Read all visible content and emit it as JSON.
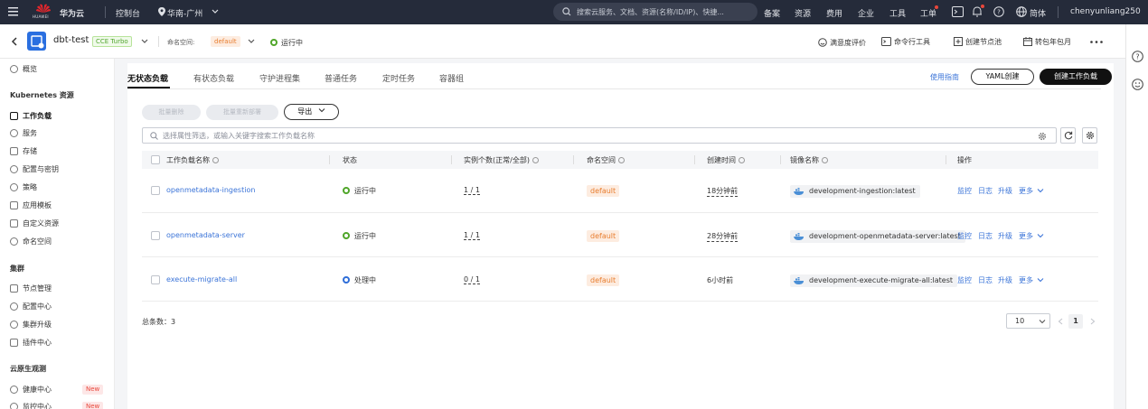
{
  "topbar": {
    "brand_text": "HUAWEI",
    "brand_name": "华为云",
    "console": "控制台",
    "region": "华南-广州",
    "search_placeholder": "搜索云服务、文档、资源(名称/ID/IP)、快捷...",
    "links": [
      "备案",
      "资源",
      "费用",
      "企业",
      "工具",
      "工单"
    ],
    "lang": "简体",
    "user": "chenyunliang250"
  },
  "cluster": {
    "name": "dbt-test",
    "type_badge": "CCE Turbo",
    "namespace_label": "命名空间:",
    "namespace_value": "default",
    "status": "运行中",
    "actions": [
      "满意度评价",
      "命令行工具",
      "创建节点池",
      "转包年包月"
    ]
  },
  "sidebar": {
    "overview": "概览",
    "k8s_section": "Kubernetes 资源",
    "k8s_items": [
      "工作负载",
      "服务",
      "存储",
      "配置与密钥",
      "策略",
      "应用模板",
      "自定义资源",
      "命名空间"
    ],
    "cluster_section": "集群",
    "cluster_items": [
      "节点管理",
      "配置中心",
      "集群升级",
      "插件中心"
    ],
    "obs_section": "云原生观测",
    "obs_items": [
      "健康中心",
      "监控中心"
    ],
    "new_badge": "New"
  },
  "tabs": [
    "无状态负载",
    "有状态负载",
    "守护进程集",
    "普通任务",
    "定时任务",
    "容器组"
  ],
  "toolbar": {
    "guide": "使用指南",
    "yaml_create": "YAML创建",
    "create_workload": "创建工作负载",
    "batch_delete": "批量删除",
    "batch_redeploy": "批量重新部署",
    "export": "导出",
    "filter_placeholder": "选择属性筛选，或输入关键字搜索工作负载名称"
  },
  "table": {
    "headers": [
      "工作负载名称",
      "状态",
      "实例个数(正常/全部)",
      "命名空间",
      "创建时间",
      "镜像名称",
      "操作"
    ],
    "rows": [
      {
        "name": "openmetadata-ingestion",
        "status": "运行中",
        "status_color": "#50a62a",
        "instances": "1 / 1",
        "namespace": "default",
        "created": "18分钟前",
        "image": "development-ingestion:latest"
      },
      {
        "name": "openmetadata-server",
        "status": "运行中",
        "status_color": "#50a62a",
        "instances": "1 / 1",
        "namespace": "default",
        "created": "28分钟前",
        "image": "development-openmetadata-server:latest"
      },
      {
        "name": "execute-migrate-all",
        "status": "处理中",
        "status_color": "#2f6ed8",
        "instances": "0 / 1",
        "namespace": "default",
        "created": "6小时前",
        "image": "development-execute-migrate-all:latest"
      }
    ],
    "ops": [
      "监控",
      "日志",
      "升级",
      "更多"
    ]
  },
  "footer": {
    "total_label": "总条数：",
    "total": "3",
    "page_size": "10",
    "page": "1"
  },
  "colors": {
    "topbar_bg": "#252b3a",
    "link": "#3b74d8",
    "running": "#50a62a",
    "processing": "#2f6ed8",
    "namespace_tag": "#e87d2e"
  }
}
